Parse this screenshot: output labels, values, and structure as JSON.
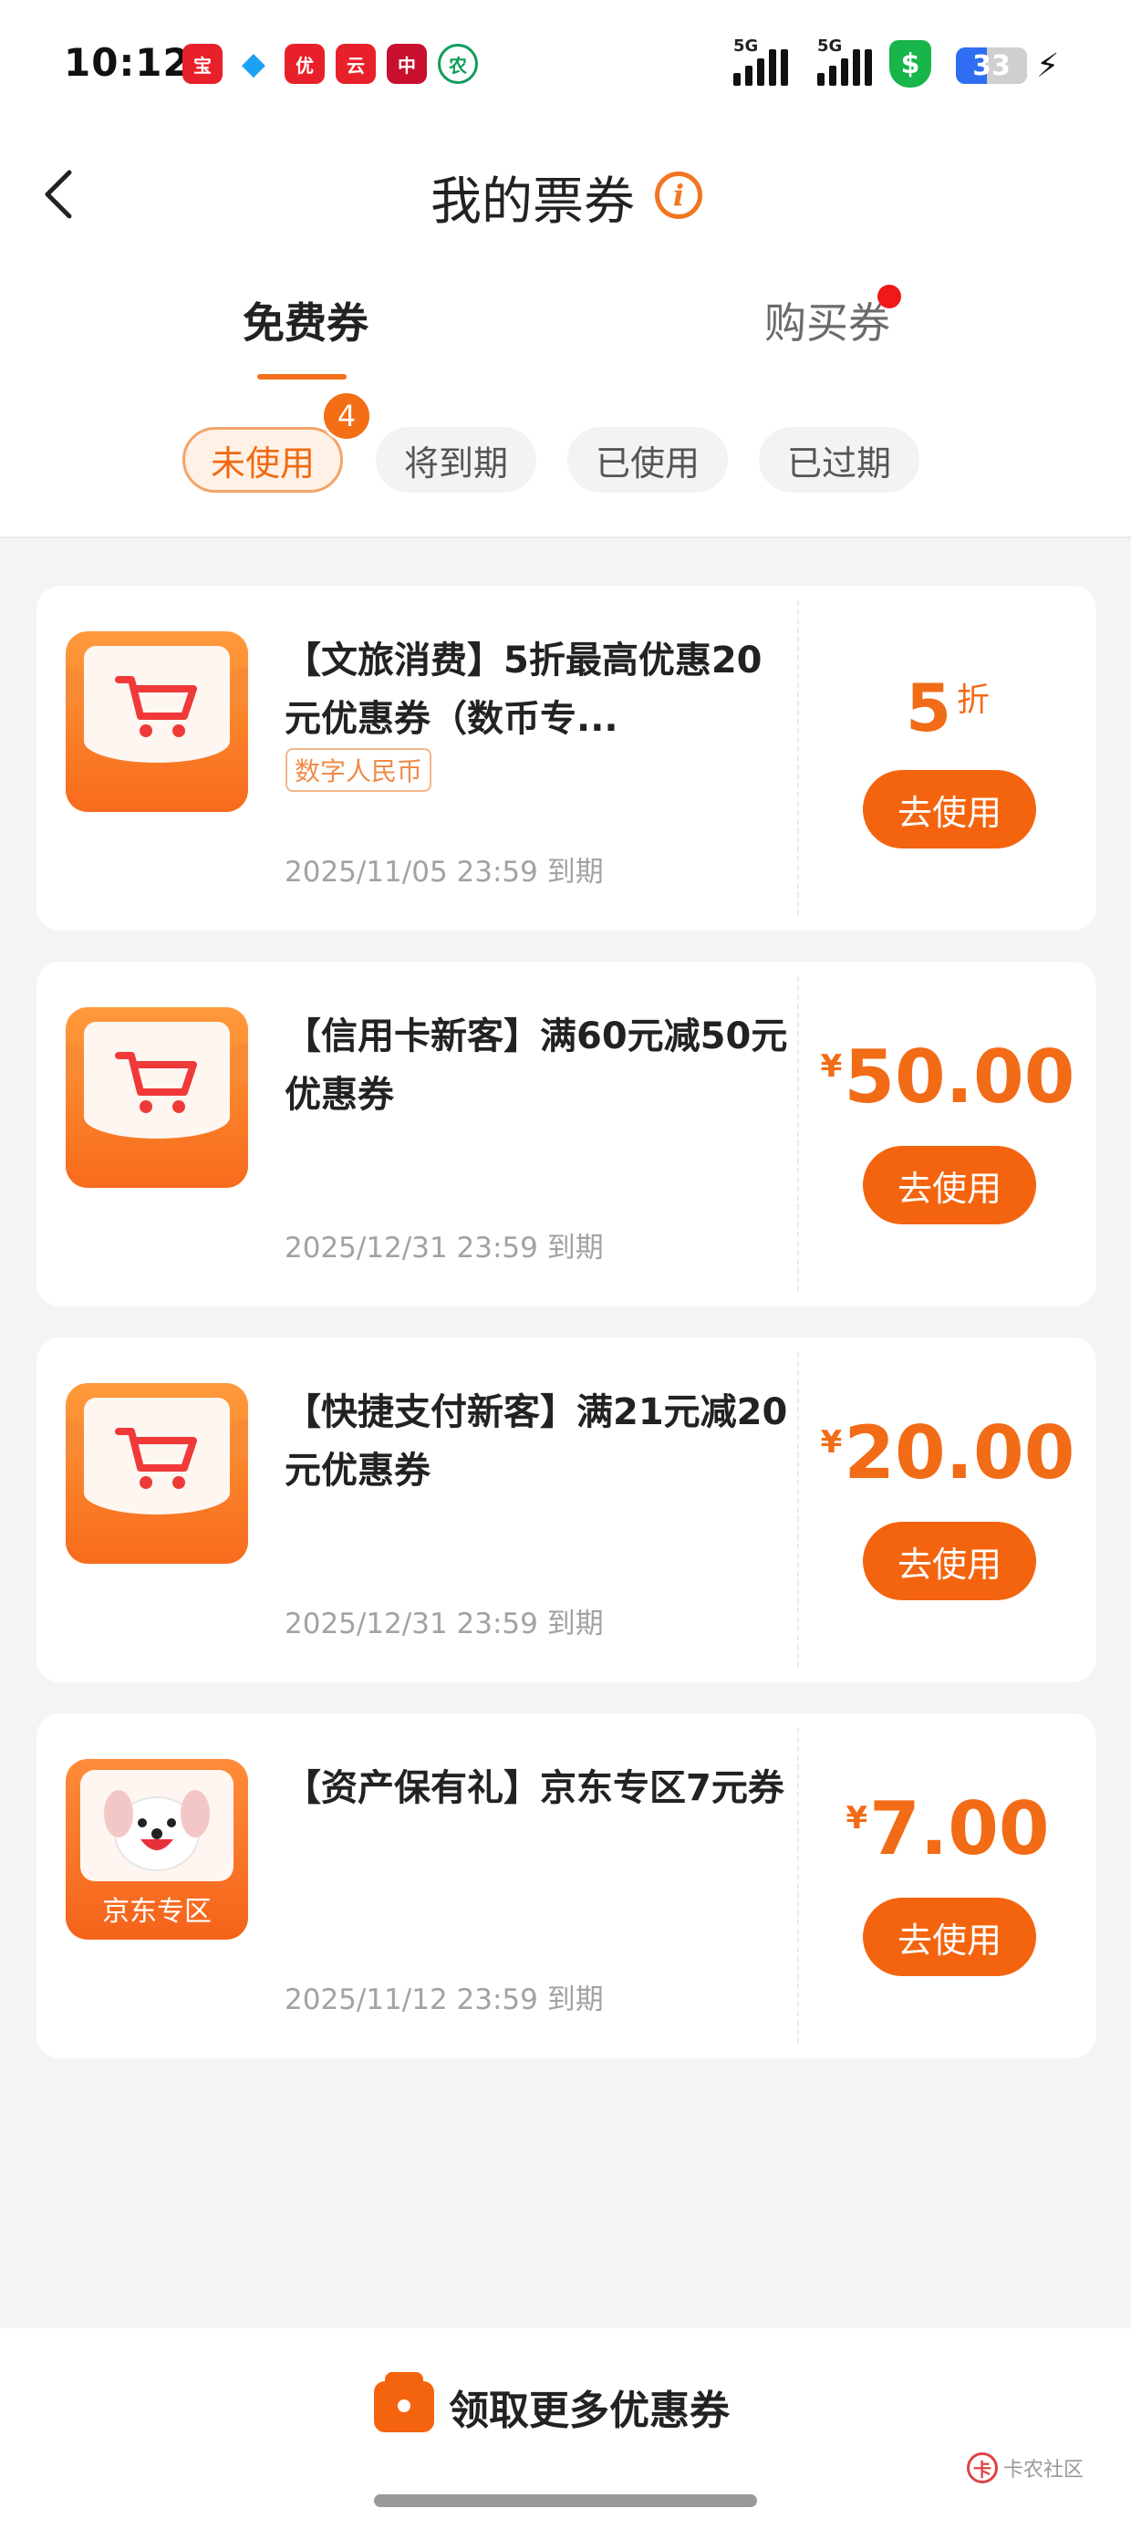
{
  "status_bar": {
    "time": "10:12",
    "network_1": "5G",
    "network_2": "5G",
    "battery": "33",
    "notification_icons": [
      {
        "name": "app-icon-1",
        "color": "#e8202a",
        "glyph": "宝"
      },
      {
        "name": "qq-icon",
        "color": "#1da1f2",
        "glyph": "🐧"
      },
      {
        "name": "app-icon-3",
        "color": "#e8202a",
        "glyph": "优"
      },
      {
        "name": "yunshanfu-icon",
        "color": "#e8202a",
        "glyph": "云"
      },
      {
        "name": "bank-icon",
        "color": "#c8102e",
        "glyph": "中"
      },
      {
        "name": "abc-bank-icon",
        "color": "#0f9d58",
        "glyph": "农"
      }
    ]
  },
  "header": {
    "title": "我的票券"
  },
  "tabs": {
    "free": "免费券",
    "purchase": "购买券"
  },
  "filters": {
    "items": [
      "未使用",
      "将到期",
      "已使用",
      "已过期"
    ],
    "active_badge": "4"
  },
  "coupons": [
    {
      "title": "【文旅消费】5折最高优惠20元优惠券（数币专...",
      "tag": "数字人民币",
      "expiry": "2025/11/05 23:59 到期",
      "currency": "",
      "amount": "5",
      "suffix": "折",
      "button": "去使用"
    },
    {
      "title": "【信用卡新客】满60元减50元优惠券",
      "expiry": "2025/12/31 23:59 到期",
      "currency": "¥",
      "amount": "50.00",
      "button": "去使用"
    },
    {
      "title": "【快捷支付新客】满21元减20元优惠券",
      "expiry": "2025/12/31 23:59 到期",
      "currency": "¥",
      "amount": "20.00",
      "button": "去使用"
    },
    {
      "title": "【资产保有礼】京东专区7元券",
      "icon_label": "京东专区",
      "expiry": "2025/11/12 23:59 到期",
      "currency": "¥",
      "amount": "7.00",
      "button": "去使用"
    }
  ],
  "bottom": {
    "more_label": "领取更多优惠券",
    "watermark": "卡农社区"
  },
  "colors": {
    "accent": "#f4640f",
    "badge_red": "#f01818"
  }
}
